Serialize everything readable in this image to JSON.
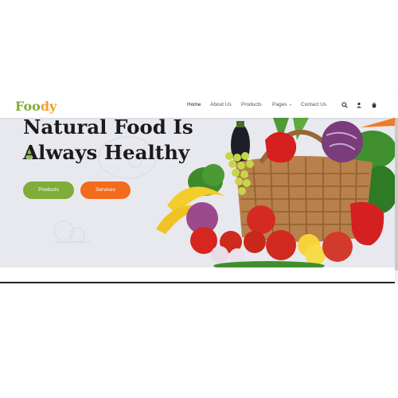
{
  "brand": {
    "part1": "Foo",
    "part2": "dy"
  },
  "nav": {
    "items": [
      {
        "label": "Home",
        "active": true
      },
      {
        "label": "About Us"
      },
      {
        "label": "Products"
      },
      {
        "label": "Pages",
        "has_dropdown": true
      },
      {
        "label": "Contact Us"
      }
    ],
    "icons": [
      "search-icon",
      "user-icon",
      "cart-icon"
    ]
  },
  "hero": {
    "title_line1": "Natural Food Is",
    "title_line2": "Always Healthy",
    "primary_button": "Products",
    "secondary_button": "Services"
  },
  "colors": {
    "brand_green": "#7fad39",
    "brand_orange": "#f36b1c",
    "hero_bg": "#e8e9ee"
  }
}
